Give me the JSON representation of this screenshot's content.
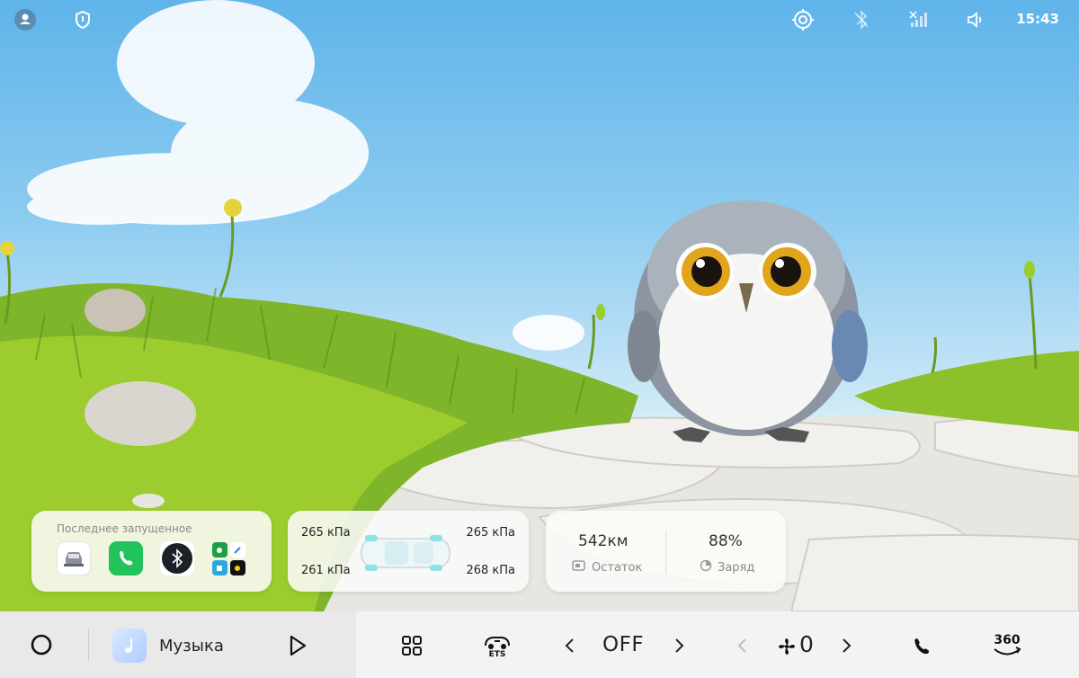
{
  "status_bar": {
    "time": "15:43",
    "icons": [
      "user-icon",
      "shield-icon",
      "target-icon",
      "bluetooth-off-icon",
      "signal-off-icon",
      "volume-icon"
    ]
  },
  "recent_card": {
    "title": "Последнее запущенное",
    "apps": [
      "car-app-icon",
      "phone-app-icon",
      "bluetooth-app-icon",
      "app-grid-icon"
    ]
  },
  "tires_card": {
    "front_left": "265 кПа",
    "front_right": "265 кПа",
    "rear_left": "261 кПа",
    "rear_right": "268 кПа"
  },
  "energy_card": {
    "range_value": "542км",
    "range_label": "Остаток",
    "charge_value": "88%",
    "charge_label": "Заряд"
  },
  "dock": {
    "music_label": "Музыка",
    "ac_value": "OFF",
    "fan_value": "0",
    "camera_label": "360",
    "ets_label": "ETS"
  },
  "colors": {
    "accent_green": "#21c35a",
    "dock_bg": "#f3f3f3",
    "card_bg": "#fafaf8"
  }
}
